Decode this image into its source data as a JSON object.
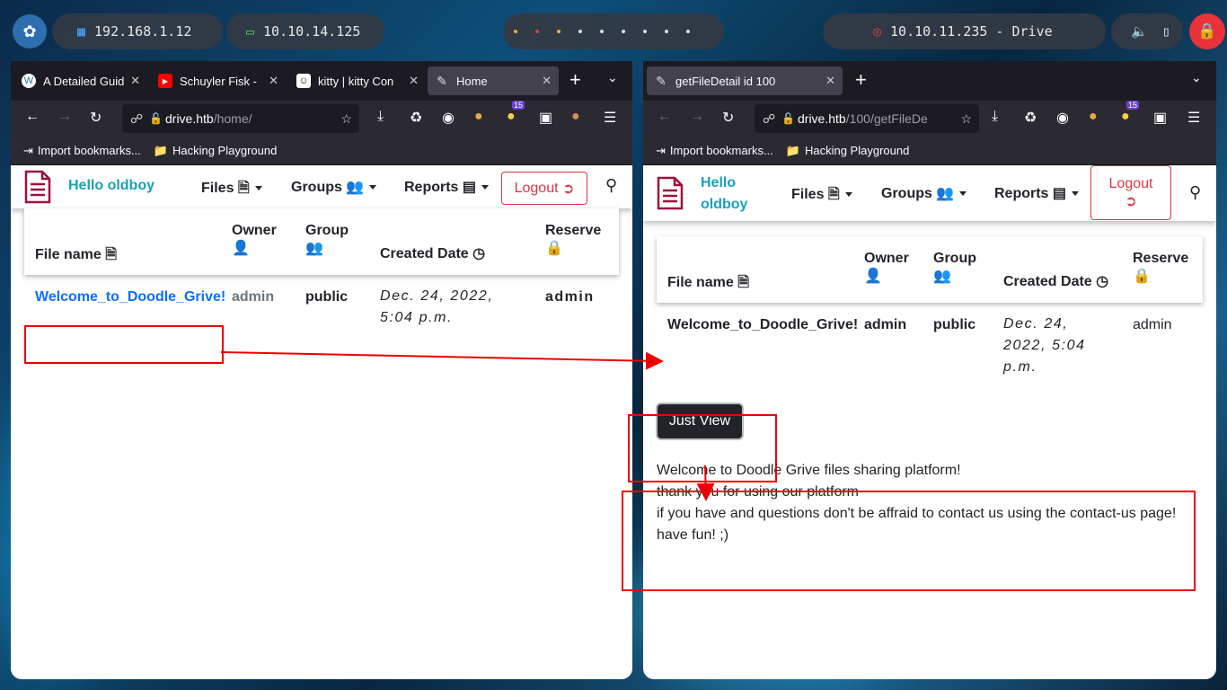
{
  "taskbar": {
    "local_ip": "192.168.1.12",
    "vpn_ip": "10.10.14.125",
    "target": "10.10.11.235 - Drive"
  },
  "left_browser": {
    "tabs": [
      {
        "label": "A Detailed Guid",
        "icon": "wordpress-icon"
      },
      {
        "label": "Schuyler Fisk -",
        "icon": "youtube-icon"
      },
      {
        "label": "kitty | kitty Con",
        "icon": "kitty-icon"
      },
      {
        "label": "Home",
        "icon": "page-icon",
        "active": true
      }
    ],
    "url_host": "drive.htb",
    "url_path": "/home/",
    "bookmarks": [
      "Import bookmarks...",
      "Hacking Playground"
    ]
  },
  "right_browser": {
    "tabs": [
      {
        "label": "getFileDetail id 100",
        "icon": "page-icon",
        "active": true
      }
    ],
    "url_host": "drive.htb",
    "url_path": "/100/getFileDe",
    "bookmarks": [
      "Import bookmarks...",
      "Hacking Playground"
    ]
  },
  "site": {
    "hello": "Hello oldboy",
    "hello_line1": "Hello",
    "hello_line2": "oldboy",
    "menu_files": "Files",
    "menu_groups": "Groups",
    "menu_reports": "Reports",
    "logout": "Logout",
    "badge_count": "15"
  },
  "table": {
    "headers": {
      "file_name": "File name",
      "owner": "Owner",
      "group": "Group",
      "created": "Created Date",
      "reserve": "Reserve"
    },
    "row": {
      "file_name": "Welcome_to_Doodle_Grive!",
      "owner": "admin",
      "group": "public",
      "created": "Dec. 24, 2022, 5:04 p.m.",
      "created_l1": "Dec. 24,",
      "created_l2": "2022, 5:04",
      "created_l3": "p.m.",
      "created_left_l1": "Dec. 24, 2022,",
      "created_left_l2": "5:04 p.m.",
      "reserve": "admin"
    }
  },
  "detail": {
    "just_view": "Just View",
    "lines": [
      "Welcome to Doodle Grive files sharing platform!",
      "thank you for using our platform",
      "if you have and questions don't be affraid to contact us using the contact-us page!",
      "have fun! ;)"
    ]
  },
  "colors": {
    "annotation": "#ee0000",
    "brand": "#a0103a",
    "hello": "#17a2b8"
  }
}
